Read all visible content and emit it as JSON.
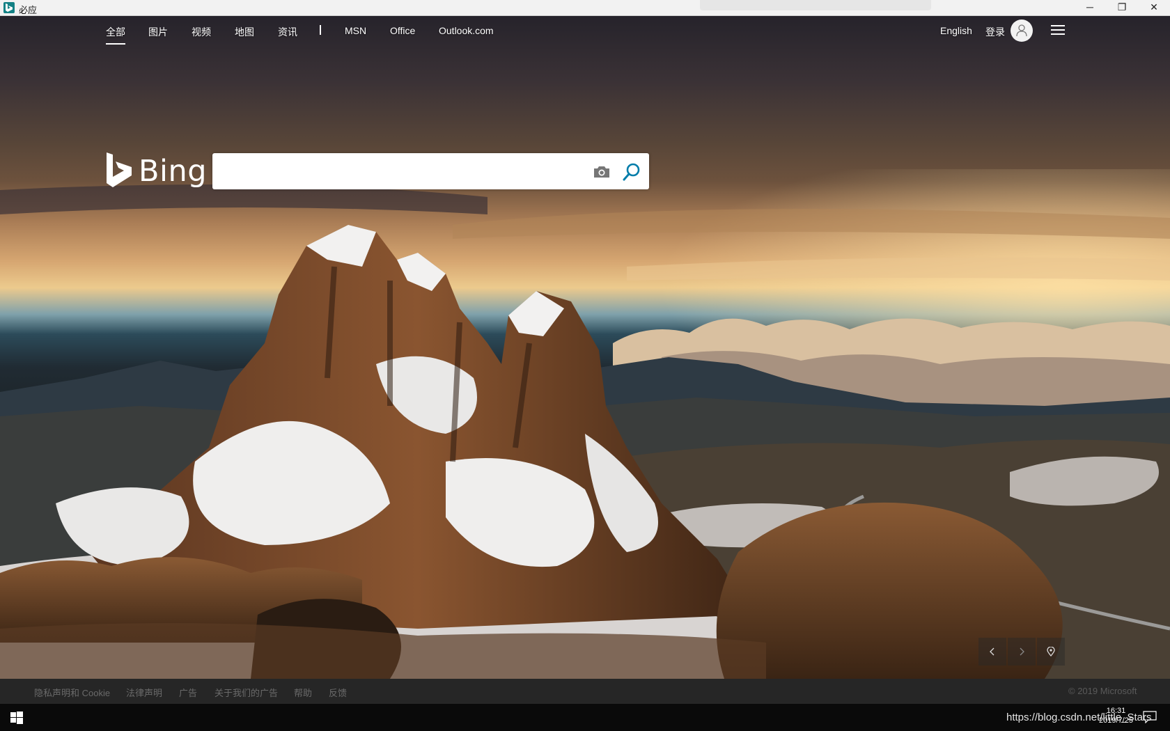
{
  "window": {
    "title": "必应",
    "minimize": "─",
    "maximize": "❐",
    "close": "✕"
  },
  "nav": {
    "items": [
      {
        "label": "全部",
        "active": true
      },
      {
        "label": "图片"
      },
      {
        "label": "视频"
      },
      {
        "label": "地图"
      },
      {
        "label": "资讯"
      },
      {
        "label": "MSN"
      },
      {
        "label": "Office"
      },
      {
        "label": "Outlook.com"
      }
    ],
    "language": "English",
    "signin": "登录"
  },
  "logo": {
    "wordmark": "Bing"
  },
  "search": {
    "value": "",
    "placeholder": ""
  },
  "footer": {
    "links": [
      "隐私声明和 Cookie",
      "法律声明",
      "广告",
      "关于我们的广告",
      "帮助",
      "反馈"
    ],
    "copyright": "© 2019 Microsoft"
  },
  "taskbar": {
    "time": "16:31",
    "date": "2019/7/25",
    "watermark": "https://blog.csdn.net/little_Stars"
  }
}
